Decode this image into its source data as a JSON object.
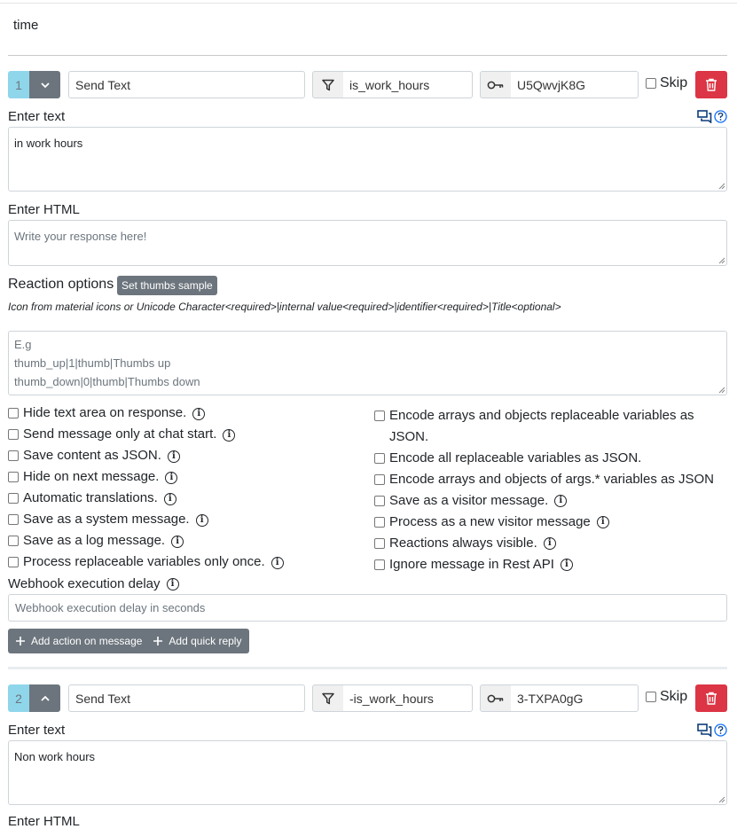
{
  "condition": {
    "label": "time"
  },
  "steps": [
    {
      "number": "1",
      "type": "Send Text",
      "condition": "is_work_hours",
      "id": "U5QwvjK8G",
      "skip_label": "Skip",
      "enter_text_label": "Enter text",
      "text_value": "in work hours",
      "enter_html_label": "Enter HTML",
      "html_placeholder": "Write your response here!",
      "reaction_label": "Reaction options",
      "thumbs_button": "Set thumbs sample",
      "reaction_hint": "Icon from material icons or Unicode Character<required>|internal value<required>|identifier<required>|Title<optional>",
      "reaction_placeholder": [
        "E.g",
        "thumb_up|1|thumb|Thumbs up",
        "thumb_down|0|thumb|Thumbs down"
      ],
      "options_left": [
        "Hide text area on response.",
        "Send message only at chat start.",
        "Save content as JSON.",
        "Hide on next message.",
        "Automatic translations.",
        "Save as a system message.",
        "Save as a log message.",
        "Process replaceable variables only once."
      ],
      "options_right": [
        "Encode arrays and objects replaceable variables as JSON.",
        "Encode all replaceable variables as JSON.",
        "Encode arrays and objects of args.* variables as JSON",
        "Save as a visitor message.",
        "Process as a new visitor message",
        "Reactions always visible.",
        "Ignore message in Rest API"
      ],
      "webhook_label": "Webhook execution delay",
      "webhook_placeholder": "Webhook execution delay in seconds",
      "add_action_label": "Add action on message",
      "add_quick_reply_label": "Add quick reply"
    },
    {
      "number": "2",
      "type": "Send Text",
      "condition": "-is_work_hours",
      "id": "3-TXPA0gG",
      "skip_label": "Skip",
      "enter_text_label": "Enter text",
      "text_value": "Non work hours",
      "enter_html_label": "Enter HTML"
    }
  ],
  "icons": {
    "toggle_1": "chevron-down-icon",
    "toggle_2": "chevron-up-icon",
    "condition": "filter-icon",
    "id": "key-icon",
    "delete": "trash-icon",
    "help": "question-circle-icon",
    "chat": "chat-bubbles-icon",
    "info": "info-circle-icon",
    "add": "plus-icon"
  },
  "colors": {
    "badge": "#8fd6eb",
    "toggle": "#6c757d",
    "delete": "#dc3545",
    "link": "#0d6efd"
  }
}
